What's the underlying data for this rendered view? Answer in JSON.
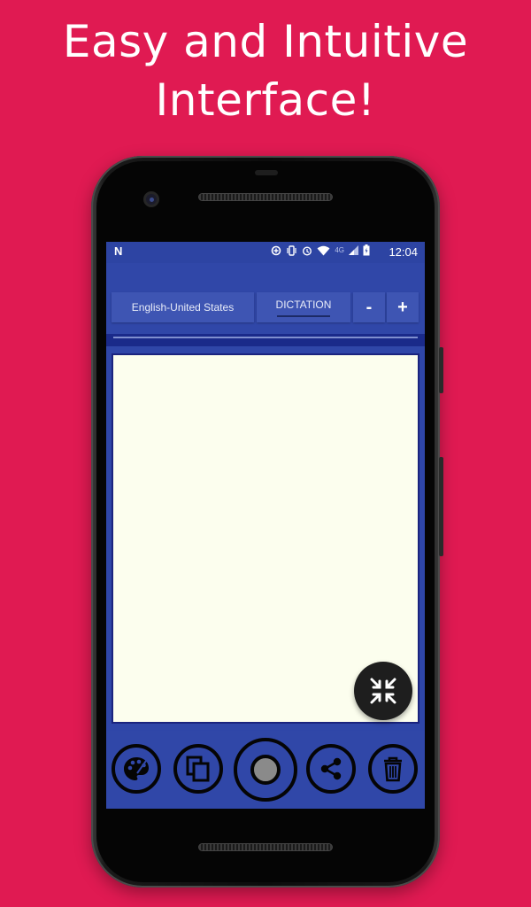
{
  "headline": {
    "line1": "Easy and Intuitive",
    "line2": "Interface!"
  },
  "statusbar": {
    "logo": "N",
    "network": "4G",
    "time": "12:04",
    "icons": [
      "data-saver-icon",
      "vibrate-icon",
      "alarm-icon",
      "wifi-icon",
      "signal-icon",
      "battery-icon"
    ]
  },
  "toolbar": {
    "language": "English-United States",
    "mode": "DICTATION",
    "decrease": "-",
    "increase": "+"
  },
  "editor": {
    "text": ""
  },
  "actions": [
    "palette-icon",
    "copy-icon",
    "record-icon",
    "share-icon",
    "delete-icon"
  ],
  "colors": {
    "background": "#e01a52",
    "primary": "#3047a8",
    "dark_band": "#1a2a8a",
    "editor_bg": "#fcfeee",
    "fab": "#1e1e1e"
  }
}
